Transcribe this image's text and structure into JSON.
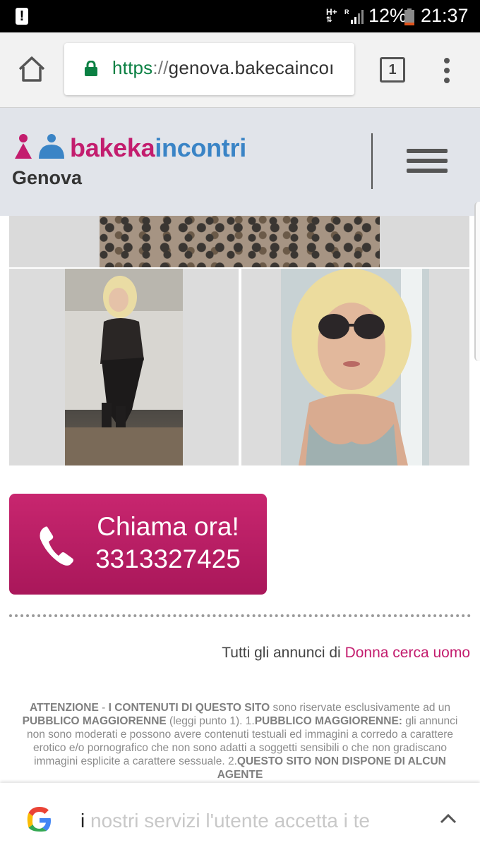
{
  "status_bar": {
    "network": "H+",
    "roaming": "R",
    "battery_percent": "12%",
    "time": "21:37"
  },
  "browser": {
    "url_scheme": "https",
    "url_separator": "://",
    "url_rest": "genova.bakecaincoı",
    "tab_count": "1"
  },
  "site": {
    "logo_part1": "bakeka",
    "logo_part2": "incontri",
    "city": "Genova",
    "brand_pink": "#c31d6e",
    "brand_blue": "#3a84c6"
  },
  "call": {
    "label": "Chiama ora!",
    "number": "3313327425"
  },
  "listing": {
    "all_ads_prefix": "Tutti gli annunci di",
    "category_link": "Donna cerca uomo"
  },
  "disclaimer": {
    "b1": "ATTENZIONE",
    "t1": " - ",
    "b2": "I CONTENUTI DI QUESTO SITO",
    "t2": " sono riservate esclusivamente ad un ",
    "b3": "PUBBLICO MAGGIORENNE",
    "t3": " (leggi punto 1). 1.",
    "b4": "PUBBLICO MAGGIORENNE:",
    "t4": " gli annunci non sono moderati e possono avere contenuti testuali ed immagini a corredo a carattere erotico e/o pornografico che non sono adatti a soggetti sensibili o che non gradiscano immagini esplicite a carattere sessuale. 2.",
    "b5": "QUESTO SITO NON DISPONE DI ALCUN AGENTE"
  },
  "google_bar": {
    "first_char": "i",
    "text": " nostri servizi l'utente accetta i te"
  }
}
